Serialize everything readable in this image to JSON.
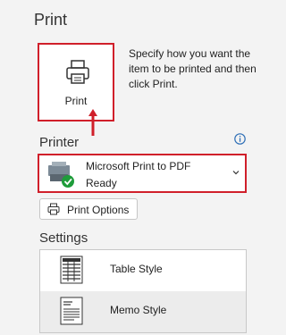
{
  "header": {
    "title": "Print"
  },
  "print_button": {
    "label": "Print"
  },
  "description": "Specify how you want the item to be printed and then click Print.",
  "printer_section": {
    "label": "Printer",
    "selected": {
      "name": "Microsoft Print to PDF",
      "status": "Ready"
    },
    "options_button_label": "Print Options"
  },
  "settings_section": {
    "label": "Settings",
    "styles": [
      {
        "label": "Table Style",
        "icon": "table-style-icon"
      },
      {
        "label": "Memo Style",
        "icon": "memo-style-icon"
      }
    ]
  },
  "colors": {
    "highlight": "#d01f2a",
    "ready_badge": "#1e9c3a"
  }
}
